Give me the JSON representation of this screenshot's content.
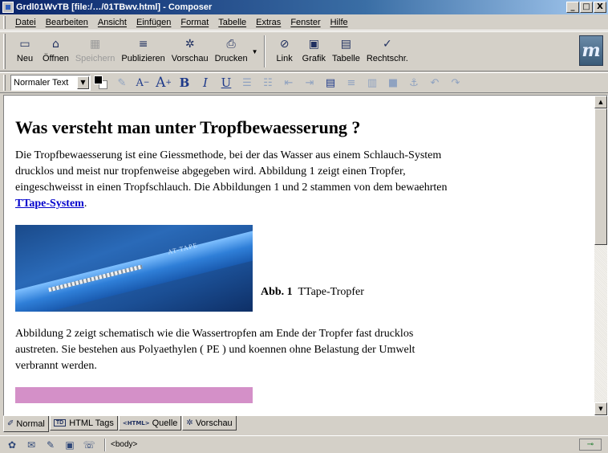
{
  "window": {
    "title": "Grdl01WvTB [file:/…/01TBwv.html] - Composer",
    "app_icon": "composer-icon",
    "buttons": {
      "minimize": "_",
      "maximize": "□",
      "close": "X"
    }
  },
  "menu": {
    "items": [
      "Datei",
      "Bearbeiten",
      "Ansicht",
      "Einfügen",
      "Format",
      "Tabelle",
      "Extras",
      "Fenster",
      "Hilfe"
    ]
  },
  "toolbar": {
    "buttons": [
      {
        "label": "Neu",
        "icon": "new-file-icon",
        "glyph": "▭",
        "disabled": false
      },
      {
        "label": "Öffnen",
        "icon": "open-folder-icon",
        "glyph": "⌂",
        "disabled": false
      },
      {
        "label": "Speichern",
        "icon": "save-icon",
        "glyph": "▦",
        "disabled": true
      },
      {
        "label": "Publizieren",
        "icon": "publish-icon",
        "glyph": "≡",
        "disabled": false
      },
      {
        "label": "Vorschau",
        "icon": "preview-icon",
        "glyph": "✲",
        "disabled": false
      },
      {
        "label": "Drucken",
        "icon": "print-icon",
        "glyph": "⎙",
        "disabled": false
      },
      {
        "label": "Link",
        "icon": "link-icon",
        "glyph": "⊘",
        "disabled": false
      },
      {
        "label": "Grafik",
        "icon": "image-icon",
        "glyph": "▣",
        "disabled": false
      },
      {
        "label": "Tabelle",
        "icon": "table-icon",
        "glyph": "▤",
        "disabled": false
      },
      {
        "label": "Rechtschr.",
        "icon": "spellcheck-icon",
        "glyph": "✓",
        "disabled": false
      }
    ],
    "logo_text": "m"
  },
  "formatbar": {
    "paragraph_style": "Normaler Text",
    "buttons": [
      {
        "name": "highlight-icon",
        "glyph": "✎",
        "dim": true
      },
      {
        "name": "font-smaller-icon",
        "glyph": "A",
        "dim": false
      },
      {
        "name": "font-larger-icon",
        "glyph": "A",
        "dim": false
      },
      {
        "name": "bold-icon",
        "glyph": "B",
        "dim": false
      },
      {
        "name": "italic-icon",
        "glyph": "I",
        "dim": false
      },
      {
        "name": "underline-icon",
        "glyph": "U",
        "dim": false
      },
      {
        "name": "bullet-list-icon",
        "glyph": "☰",
        "dim": true
      },
      {
        "name": "numbered-list-icon",
        "glyph": "☷",
        "dim": true
      },
      {
        "name": "outdent-icon",
        "glyph": "⇤",
        "dim": true
      },
      {
        "name": "indent-icon",
        "glyph": "⇥",
        "dim": true
      },
      {
        "name": "align-left-icon",
        "glyph": "▤",
        "dim": false
      },
      {
        "name": "align-center-icon",
        "glyph": "≡",
        "dim": true
      },
      {
        "name": "align-right-icon",
        "glyph": "▥",
        "dim": true
      },
      {
        "name": "justify-icon",
        "glyph": "■",
        "dim": true
      },
      {
        "name": "anchor-icon",
        "glyph": "⚓",
        "dim": true
      },
      {
        "name": "undo-icon",
        "glyph": "↶",
        "dim": true
      },
      {
        "name": "redo-icon",
        "glyph": "↷",
        "dim": true
      }
    ]
  },
  "document": {
    "heading": "Was versteht man unter Tropfbewaesserung ?",
    "para1_text": "Die Tropfbewaesserung ist eine Giessmethode, bei der das Wasser aus einem Schlauch-System drucklos und meist nur tropfenweise abgegeben wird. Abbildung 1 zeigt einen Tropfer, eingeschweisst in einen Tropfschlauch. Die Abbildungen 1 und 2 stammen von dem bewaehrten ",
    "para1_link": "TTape-System",
    "para1_end": ".",
    "figure1_image_text": "AT-TAPE",
    "figure1_caption_label": "Abb. 1",
    "figure1_caption_text": "TTape-Tropfer",
    "para2": "Abbildung 2 zeigt schematisch wie die Wassertropfen am Ende der Tropfer fast drucklos austreten. Sie bestehen aus Polyaethylen ( PE ) und koennen ohne Belastung der Umwelt verbrannt werden."
  },
  "edit_tabs": [
    {
      "label": "Normal",
      "icon": "pencil-icon",
      "glyph": "✐",
      "active": true
    },
    {
      "label": "HTML Tags",
      "icon": "html-tags-icon",
      "glyph": "TD",
      "active": false
    },
    {
      "label": "Quelle",
      "icon": "source-icon",
      "glyph": "<HTML>",
      "active": false
    },
    {
      "label": "Vorschau",
      "icon": "preview-tab-icon",
      "glyph": "✲",
      "active": false
    }
  ],
  "statusbar": {
    "icons": [
      {
        "name": "navigator-icon",
        "glyph": "✿"
      },
      {
        "name": "mail-icon",
        "glyph": "✉"
      },
      {
        "name": "composer-icon",
        "glyph": "✎"
      },
      {
        "name": "address-book-icon",
        "glyph": "▣"
      },
      {
        "name": "chat-icon",
        "glyph": "☏"
      }
    ],
    "tag": "<body>",
    "right_icon": "connection-icon",
    "right_glyph": "⊸"
  }
}
